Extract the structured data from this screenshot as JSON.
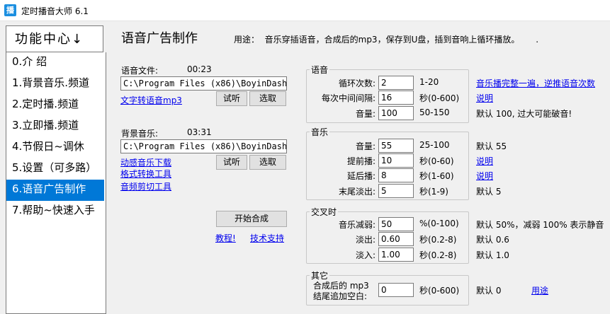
{
  "window": {
    "icon_char": "播",
    "title": "定时播音大师 6.1"
  },
  "sidebar": {
    "header": "功能中心↓",
    "items": [
      {
        "label": "0.介 绍"
      },
      {
        "label": "1.背景音乐.频道"
      },
      {
        "label": "2.定时播.频道"
      },
      {
        "label": "3.立即播.频道"
      },
      {
        "label": "4.节假日~调休"
      },
      {
        "label": "5.设置（可多路）"
      },
      {
        "label": "6.语音广告制作",
        "selected": true
      },
      {
        "label": "7.帮助~快速入手"
      }
    ]
  },
  "main": {
    "title": "语音广告制作",
    "usage": "用途：  音乐穿插语音，合成后的mp3，保存到U盘，插到音响上循环播放。      .",
    "voice_file": {
      "label": "语音文件:",
      "duration": "00:23",
      "path": "C:\\Program Files (x86)\\BoyinDashi",
      "tts_link": "文字转语音mp3",
      "listen": "试听",
      "select": "选取"
    },
    "bg_music": {
      "label": "背景音乐:",
      "duration": "03:31",
      "path": "C:\\Program Files (x86)\\BoyinDashi",
      "links": [
        "动感音乐下载",
        "格式转换工具",
        "音频剪切工具"
      ],
      "listen": "试听",
      "select": "选取"
    },
    "start_button": "开始合成",
    "tutorial_link": "教程!",
    "support_link": "技术支持"
  },
  "groups": {
    "voice": {
      "title": "语音",
      "rows": [
        {
          "label": "循环次数:",
          "value": "2",
          "range": "1-20",
          "note": "音乐播完整一遍，逆推语音次数",
          "note_link": true
        },
        {
          "label": "每次中间间隔:",
          "value": "16",
          "range": "秒(0-600)",
          "note": "说明",
          "note_link": true
        },
        {
          "label": "音量:",
          "value": "100",
          "range": "50-150",
          "note": "默认 100, 过大可能破音!",
          "note_link": false
        }
      ]
    },
    "music": {
      "title": "音乐",
      "rows": [
        {
          "label": "音量:",
          "value": "55",
          "range": "25-100",
          "note": "默认 55",
          "note_link": false
        },
        {
          "label": "提前播:",
          "value": "10",
          "range": "秒(0-60)",
          "note": "说明",
          "note_link": true
        },
        {
          "label": "延后播:",
          "value": "8",
          "range": "秒(1-60)",
          "note": "说明",
          "note_link": true
        },
        {
          "label": "末尾淡出:",
          "value": "5",
          "range": "秒(1-9)",
          "note": "默认 5",
          "note_link": false
        }
      ]
    },
    "cross": {
      "title": "交叉时",
      "rows": [
        {
          "label": "音乐减弱:",
          "value": "50",
          "range": "%(0-100)",
          "note": "默认 50%，减弱 100% 表示静音",
          "note_link": false
        },
        {
          "label": "淡出:",
          "value": "0.60",
          "range": "秒(0.2-8)",
          "note": "默认 0.6",
          "note_link": false
        },
        {
          "label": "淡入:",
          "value": "1.00",
          "range": "秒(0.2-8)",
          "note": "默认 1.0",
          "note_link": false
        }
      ]
    },
    "other": {
      "title": "其它",
      "label_line1": "合成后的 mp3",
      "label_line2": "结尾追加空白:",
      "value": "0",
      "range": "秒(0-600)",
      "note": "默认 0",
      "usage_link": "用途"
    }
  }
}
